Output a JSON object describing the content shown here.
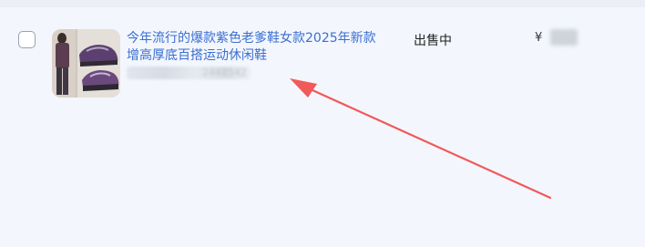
{
  "product": {
    "title": "今年流行的爆款紫色老爹鞋女款2025年新款增高厚底百搭运动休闲鞋",
    "id_partial": "2448542",
    "status": "出售中",
    "currency_symbol": "¥"
  },
  "colors": {
    "title_link": "#3a6fd1",
    "row_background": "#f3f6fd",
    "annotation_arrow": "#f05a5a"
  },
  "icons": {
    "annotation": "arrow-annotation"
  }
}
